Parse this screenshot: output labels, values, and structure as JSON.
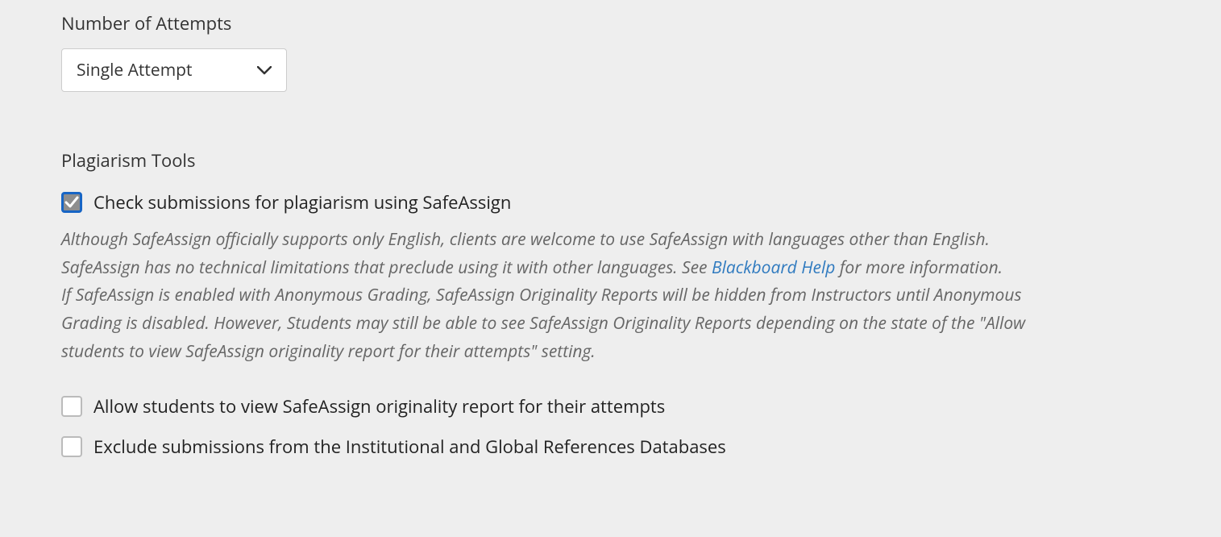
{
  "attempts": {
    "label": "Number of Attempts",
    "selected": "Single Attempt"
  },
  "plagiarism": {
    "heading": "Plagiarism Tools",
    "check_safeassign": {
      "label": "Check submissions for plagiarism using SafeAssign",
      "checked": true
    },
    "help": {
      "p1_a": "Although SafeAssign officially supports only English, clients are welcome to use SafeAssign with languages other than English. SafeAssign has no technical limitations that preclude using it with other languages. See ",
      "link_text": "Blackboard Help",
      "p1_b": " for more information.",
      "p2": "If SafeAssign is enabled with Anonymous Grading, SafeAssign Originality Reports will be hidden from Instructors until Anonymous Grading is disabled. However, Students may still be able to see SafeAssign Originality Reports depending on the state of the \"Allow students to view SafeAssign originality report for their attempts\" setting."
    },
    "allow_students": {
      "label": "Allow students to view SafeAssign originality report for their attempts",
      "checked": false
    },
    "exclude_submissions": {
      "label": "Exclude submissions from the Institutional and Global References Databases",
      "checked": false
    }
  }
}
